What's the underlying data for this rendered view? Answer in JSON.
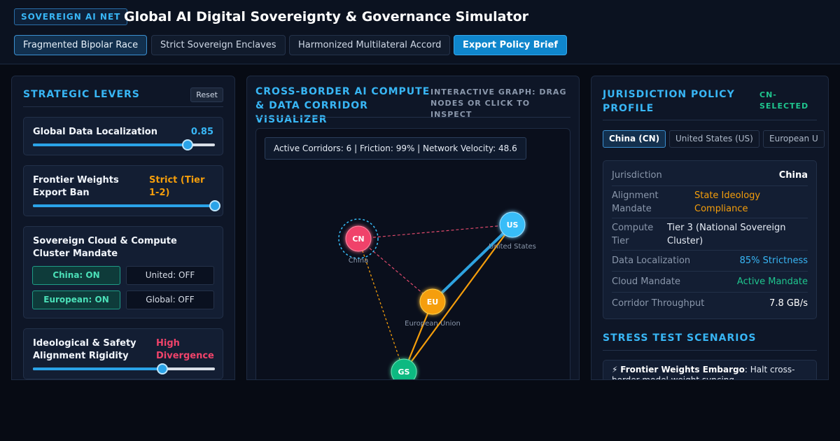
{
  "header": {
    "badge": "SOVEREIGN AI NET",
    "title": "Global AI Digital Sovereignty & Governance Simulator",
    "scenarios": [
      "Fragmented Bipolar Race",
      "Strict Sovereign Enclaves",
      "Harmonized Multilateral Accord"
    ],
    "active_scenario": "Fragmented Bipolar Race",
    "export_label": "Export Policy Brief"
  },
  "levers": {
    "title": "STRATEGIC LEVERS",
    "reset_label": "Reset",
    "data_localization": {
      "label": "Global Data Localization",
      "value": "0.85",
      "level": 0.85
    },
    "weights_ban": {
      "label": "Frontier Weights Export Ban",
      "value": "Strict (Tier 1-2)",
      "level": 1.0
    },
    "cloud_mandate": {
      "label": "Sovereign Cloud & Compute Cluster Mandate",
      "toggles": [
        {
          "label": "China: ON",
          "on": true
        },
        {
          "label": "United: OFF",
          "on": false
        },
        {
          "label": "European: ON",
          "on": true
        },
        {
          "label": "Global: OFF",
          "on": false
        }
      ]
    },
    "alignment": {
      "label": "Ideological & Safety Alignment Rigidity",
      "value": "High Divergence",
      "level": 0.71
    }
  },
  "graph": {
    "title": "CROSS-BORDER AI COMPUTE & DATA CORRIDOR VISUALIZER",
    "hint": "INTERACTIVE GRAPH: DRAG NODES OR CLICK TO INSPECT",
    "stats": "Active Corridors: 6 | Friction: 99% | Network Velocity: 48.6",
    "nodes": [
      {
        "id": "CN",
        "name": "China",
        "color": "#f0436a"
      },
      {
        "id": "US",
        "name": "United States",
        "color": "#38bdf8"
      },
      {
        "id": "EU",
        "name": "European Union",
        "color": "#f59e0b"
      },
      {
        "id": "GS",
        "name": "",
        "color": "#10b981"
      }
    ]
  },
  "profile": {
    "title": "JURISDICTION POLICY PROFILE",
    "status": "CN-SELECTED",
    "tabs": [
      "China (CN)",
      "United States (US)",
      "European U"
    ],
    "rows": [
      {
        "label": "Jurisdiction",
        "value": "China"
      },
      {
        "label": "Alignment Mandate",
        "value": "State Ideology Compliance"
      },
      {
        "label": "Compute Tier",
        "value": "Tier 3 (National Sovereign Cluster)"
      },
      {
        "label": "Data Localization",
        "value": "85% Strictness"
      },
      {
        "label": "Cloud Mandate",
        "value": "Active Mandate"
      },
      {
        "label": "Corridor Throughput",
        "value": "7.8 GB/s"
      }
    ]
  },
  "stress": {
    "title": "STRESS TEST SCENARIOS",
    "card_icon": "⚡",
    "card_title": "Frontier Weights Embargo",
    "card_text": ": Halt cross-border model weight syncing."
  }
}
